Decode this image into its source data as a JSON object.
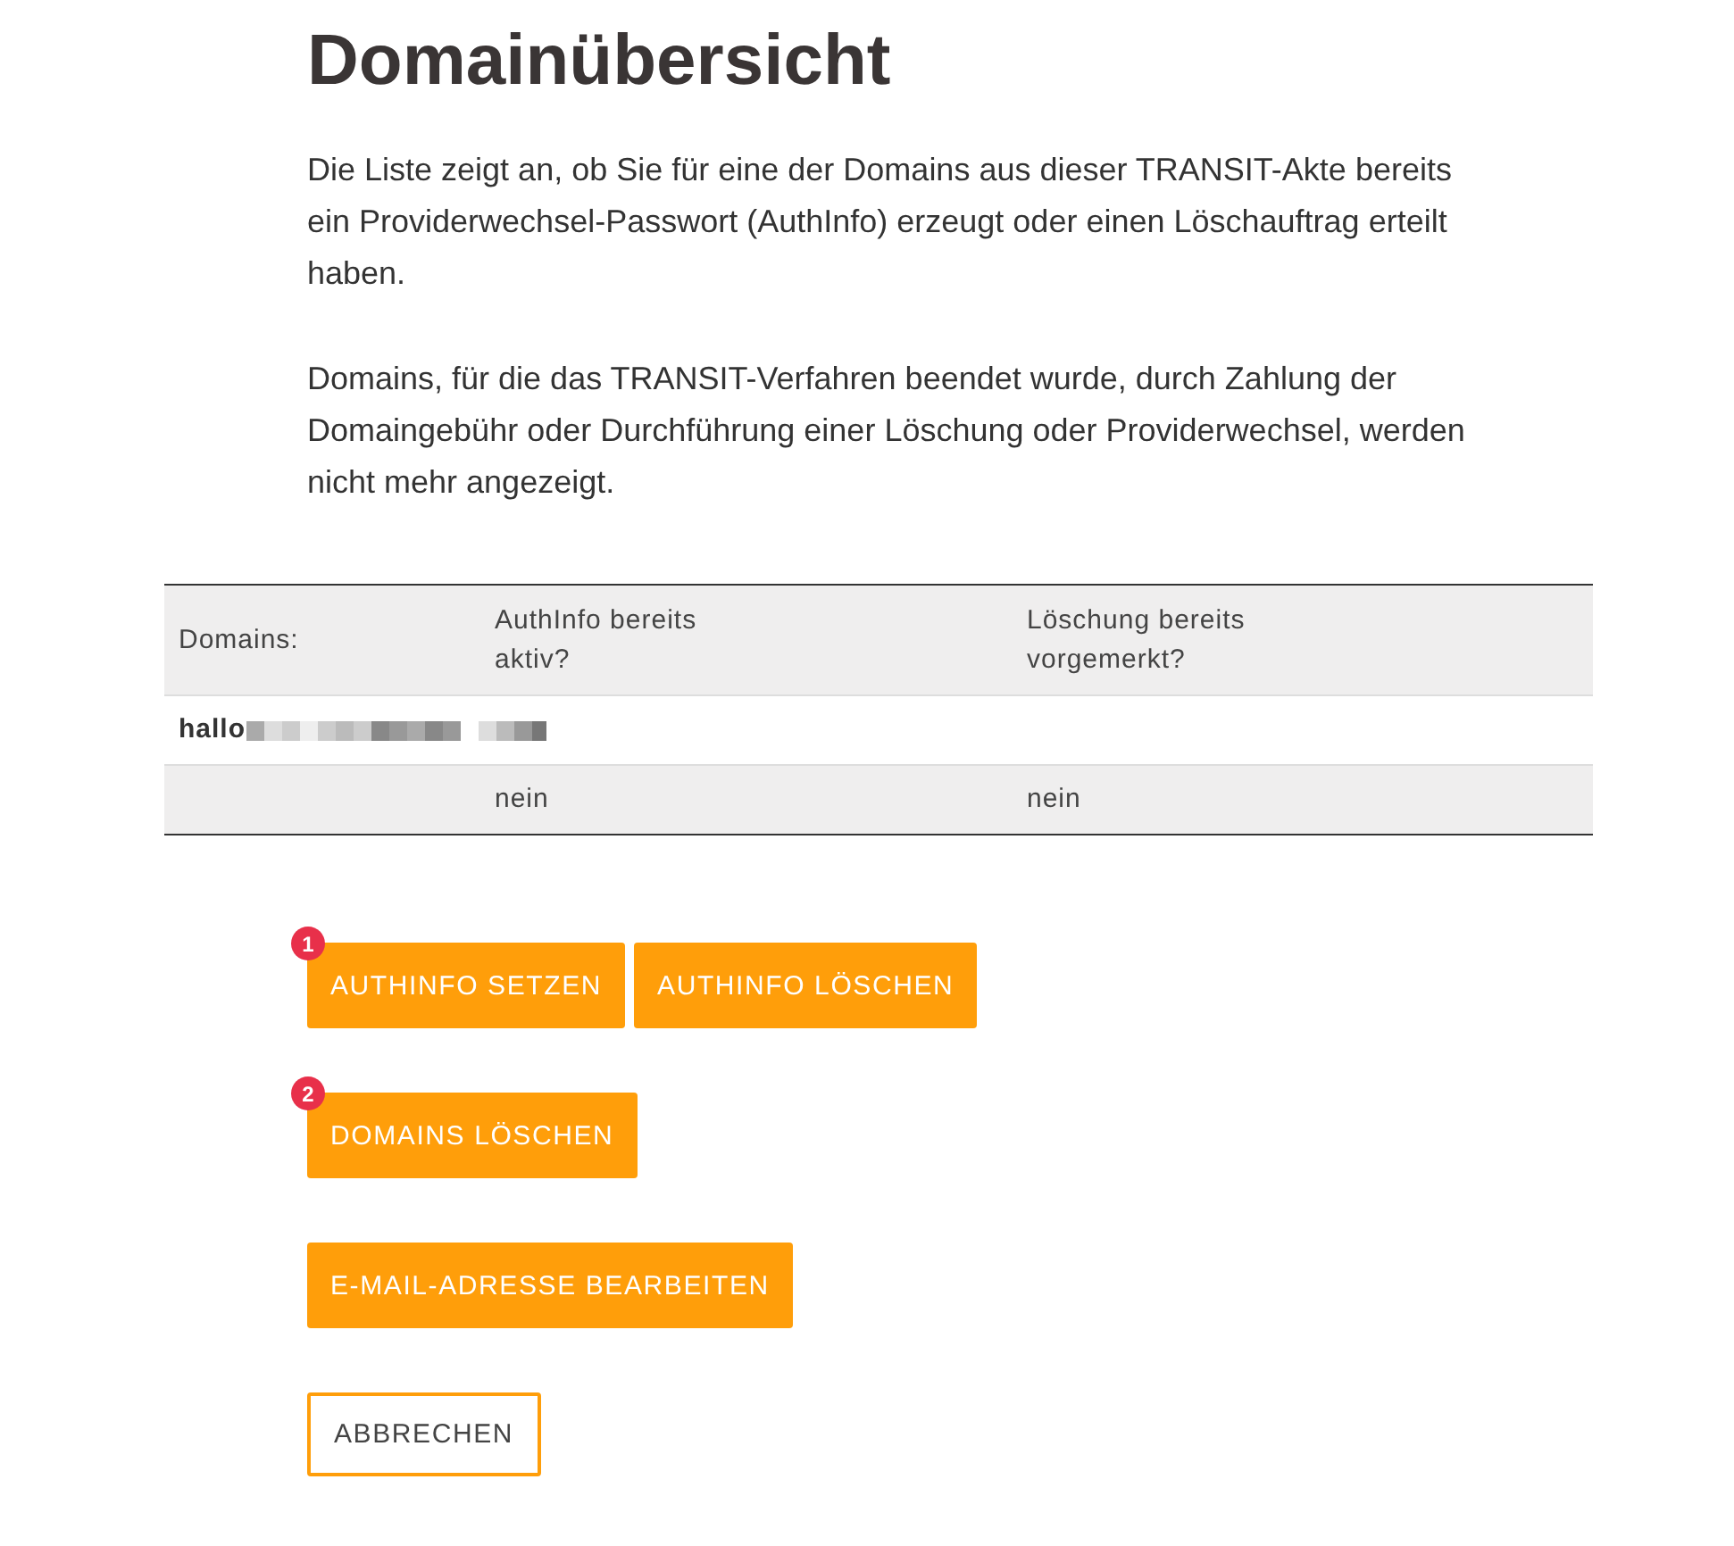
{
  "title": "Domainübersicht",
  "paragraphs": [
    "Die Liste zeigt an, ob Sie für eine der Domains aus dieser TRANSIT-Akte bereits ein Providerwechsel-Passwort (AuthInfo) erzeugt oder einen Löschauftrag erteilt haben.",
    "Domains, für die das TRANSIT-Verfahren beendet wurde, durch Zahlung der Domaingebühr oder Durchführung einer Löschung oder Providerwechsel, werden nicht mehr angezeigt."
  ],
  "table": {
    "columns": [
      "Domains:",
      "AuthInfo bereits aktiv?",
      "Löschung bereits vorgemerkt?"
    ],
    "rows": [
      {
        "domain": "hallo",
        "authinfo": "nein",
        "deletion": "nein"
      }
    ]
  },
  "button_groups": [
    {
      "badge": "1",
      "buttons": [
        {
          "label": "AUTHINFO SETZEN",
          "kind": "primary"
        },
        {
          "label": "AUTHINFO LÖSCHEN",
          "kind": "primary"
        }
      ]
    },
    {
      "badge": "2",
      "buttons": [
        {
          "label": "DOMAINS LÖSCHEN",
          "kind": "primary"
        }
      ]
    },
    {
      "buttons": [
        {
          "label": "E-MAIL-ADRESSE BEARBEITEN",
          "kind": "primary"
        }
      ]
    },
    {
      "buttons": [
        {
          "label": "ABBRECHEN",
          "kind": "secondary"
        }
      ]
    }
  ]
}
